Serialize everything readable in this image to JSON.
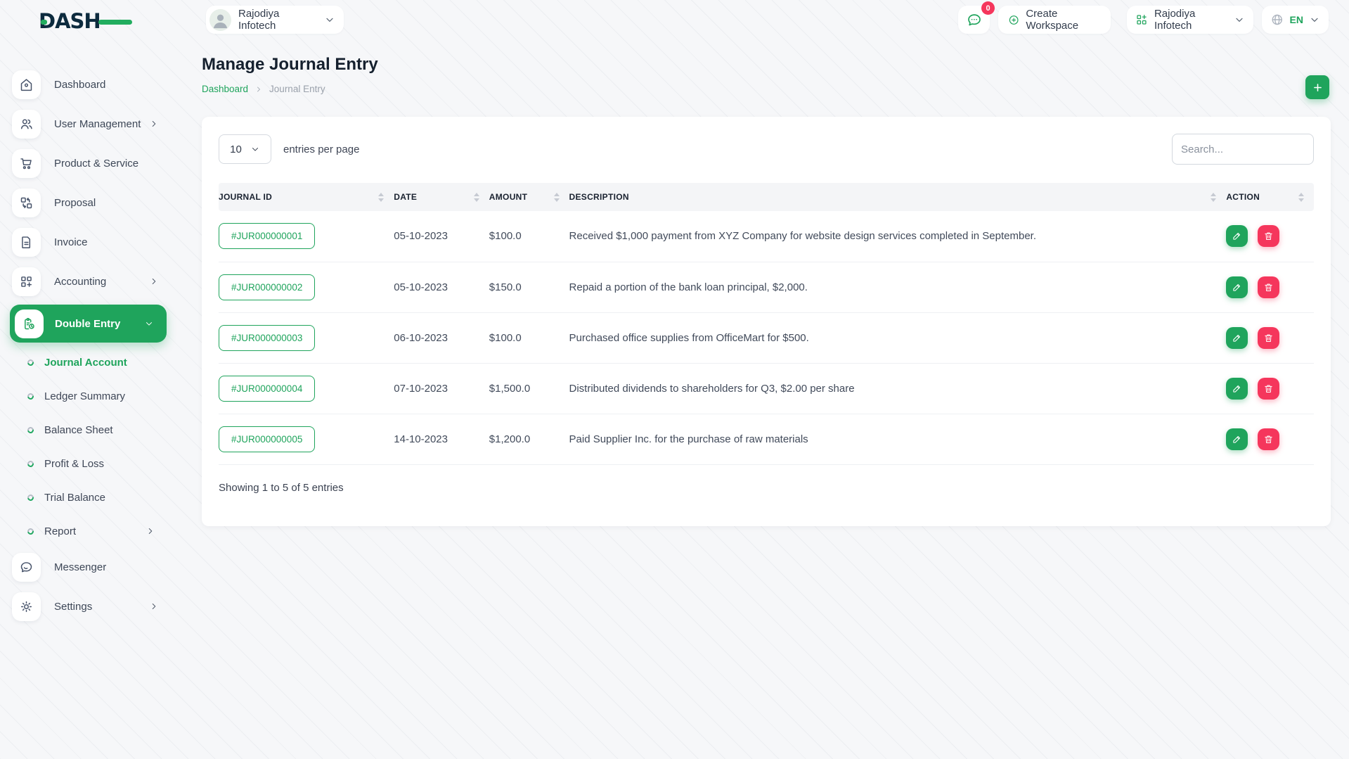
{
  "brand": {
    "name": "DASH"
  },
  "header": {
    "workspace_selector": {
      "label": "Rajodiya Infotech"
    },
    "notification": {
      "count": "0"
    },
    "create_workspace": {
      "label": "Create Workspace"
    },
    "company_selector": {
      "label": "Rajodiya Infotech"
    },
    "language": {
      "label": "EN"
    }
  },
  "sidebar": {
    "items_top": [
      {
        "label": "Dashboard",
        "icon": "home-icon"
      },
      {
        "label": "User Management",
        "icon": "users-icon",
        "chevron": "right"
      },
      {
        "label": "Product & Service",
        "icon": "cart-icon"
      },
      {
        "label": "Proposal",
        "icon": "proposal-icon"
      },
      {
        "label": "Invoice",
        "icon": "invoice-icon"
      },
      {
        "label": "Accounting",
        "icon": "accounting-icon",
        "chevron": "right"
      },
      {
        "label": "Double Entry",
        "icon": "double-entry-icon",
        "chevron": "down",
        "active": true
      }
    ],
    "sub_items": [
      {
        "label": "Journal Account",
        "active": true
      },
      {
        "label": "Ledger Summary"
      },
      {
        "label": "Balance Sheet"
      },
      {
        "label": "Profit & Loss"
      },
      {
        "label": "Trial Balance"
      },
      {
        "label": "Report",
        "chevron": "right"
      }
    ],
    "items_bottom": [
      {
        "label": "Messenger",
        "icon": "messenger-icon"
      },
      {
        "label": "Settings",
        "icon": "settings-icon",
        "chevron": "right"
      }
    ]
  },
  "page": {
    "title": "Manage Journal Entry",
    "breadcrumb": {
      "home": "Dashboard",
      "current": "Journal Entry"
    }
  },
  "toolbar": {
    "entries_value": "10",
    "entries_label": "entries per page",
    "search_placeholder": "Search..."
  },
  "table": {
    "columns": [
      "JOURNAL ID",
      "DATE",
      "AMOUNT",
      "DESCRIPTION",
      "ACTION"
    ],
    "rows": [
      {
        "journal_id": "#JUR000000001",
        "date": "05-10-2023",
        "amount": "$100.0",
        "description": "Received $1,000 payment from XYZ Company for website design services completed in September."
      },
      {
        "journal_id": "#JUR000000002",
        "date": "05-10-2023",
        "amount": "$150.0",
        "description": "Repaid a portion of the bank loan principal, $2,000."
      },
      {
        "journal_id": "#JUR000000003",
        "date": "06-10-2023",
        "amount": "$100.0",
        "description": "Purchased office supplies from OfficeMart for $500."
      },
      {
        "journal_id": "#JUR000000004",
        "date": "07-10-2023",
        "amount": "$1,500.0",
        "description": "Distributed dividends to shareholders for Q3, $2.00 per share"
      },
      {
        "journal_id": "#JUR000000005",
        "date": "14-10-2023",
        "amount": "$1,200.0",
        "description": "Paid Supplier Inc. for the purchase of raw materials"
      }
    ],
    "footer": "Showing 1 to 5 of 5 entries"
  },
  "colors": {
    "accent_green": "#1fa45c",
    "danger_pink": "#f5365c",
    "brand_navy": "#0d2b3e"
  }
}
